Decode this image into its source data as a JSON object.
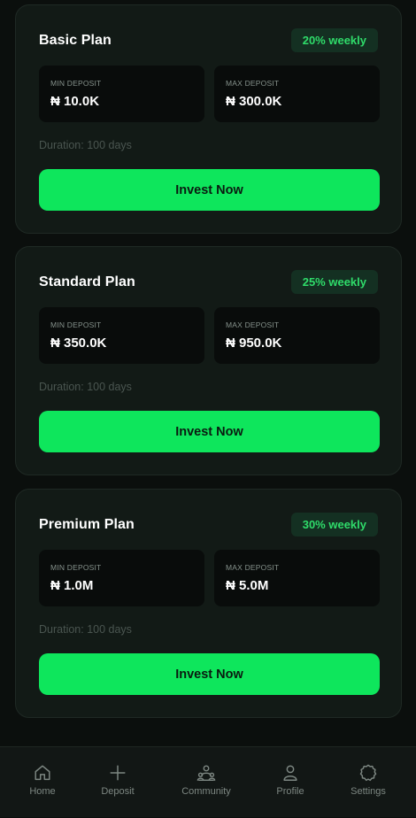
{
  "plans": [
    {
      "name": "Basic Plan",
      "rate": "20% weekly",
      "min_label": "MIN DEPOSIT",
      "min_value": "₦ 10.0K",
      "max_label": "MAX DEPOSIT",
      "max_value": "₦ 300.0K",
      "duration": "Duration: 100 days",
      "button_label": "Invest Now"
    },
    {
      "name": "Standard Plan",
      "rate": "25% weekly",
      "min_label": "MIN DEPOSIT",
      "min_value": "₦ 350.0K",
      "max_label": "MAX DEPOSIT",
      "max_value": "₦ 950.0K",
      "duration": "Duration: 100 days",
      "button_label": "Invest Now"
    },
    {
      "name": "Premium Plan",
      "rate": "30% weekly",
      "min_label": "MIN DEPOSIT",
      "min_value": "₦ 1.0M",
      "max_label": "MAX DEPOSIT",
      "max_value": "₦ 5.0M",
      "duration": "Duration: 100 days",
      "button_label": "Invest Now"
    }
  ],
  "nav": {
    "items": [
      {
        "label": "Home",
        "icon": "home-icon"
      },
      {
        "label": "Deposit",
        "icon": "plus-icon"
      },
      {
        "label": "Community",
        "icon": "community-icon"
      },
      {
        "label": "Profile",
        "icon": "user-icon"
      },
      {
        "label": "Settings",
        "icon": "gear-icon"
      }
    ]
  },
  "colors": {
    "background": "#0b0f0d",
    "card": "#121a16",
    "accent": "#0ee65c",
    "badge_text": "#2fdc6a",
    "badge_bg": "#143022"
  }
}
